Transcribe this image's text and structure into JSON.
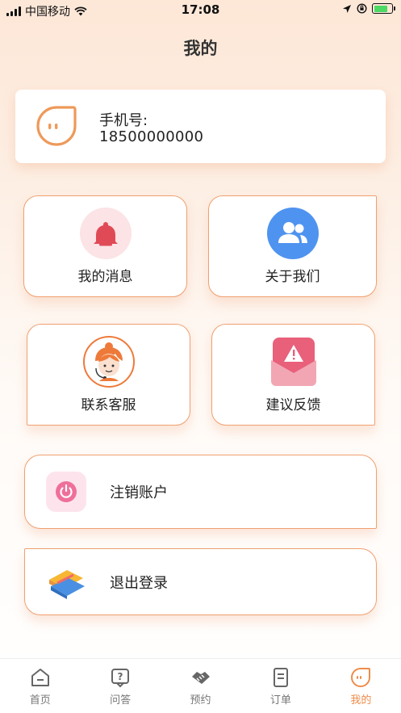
{
  "status_bar": {
    "carrier": "中国移动",
    "time": "17:08"
  },
  "page": {
    "title": "我的"
  },
  "user": {
    "phone_label": "手机号:",
    "phone": "18500000000"
  },
  "tiles": [
    {
      "label": "我的消息",
      "icon": "bell-icon"
    },
    {
      "label": "关于我们",
      "icon": "users-icon"
    },
    {
      "label": "联系客服",
      "icon": "customer-service-icon"
    },
    {
      "label": "建议反馈",
      "icon": "feedback-envelope-icon"
    }
  ],
  "rows": [
    {
      "label": "注销账户",
      "icon": "power-icon"
    },
    {
      "label": "退出登录",
      "icon": "logout-icon"
    }
  ],
  "tabs": [
    {
      "label": "首页",
      "icon": "home-icon",
      "active": false
    },
    {
      "label": "问答",
      "icon": "question-icon",
      "active": false
    },
    {
      "label": "预约",
      "icon": "handshake-icon",
      "active": false
    },
    {
      "label": "订单",
      "icon": "order-icon",
      "active": false
    },
    {
      "label": "我的",
      "icon": "profile-icon",
      "active": true
    }
  ],
  "colors": {
    "accent": "#ee8c4a",
    "tile_border": "#f0a070",
    "bell": "#e04a57",
    "users_bg": "#4f93f0",
    "power": "#ef6f9b"
  }
}
